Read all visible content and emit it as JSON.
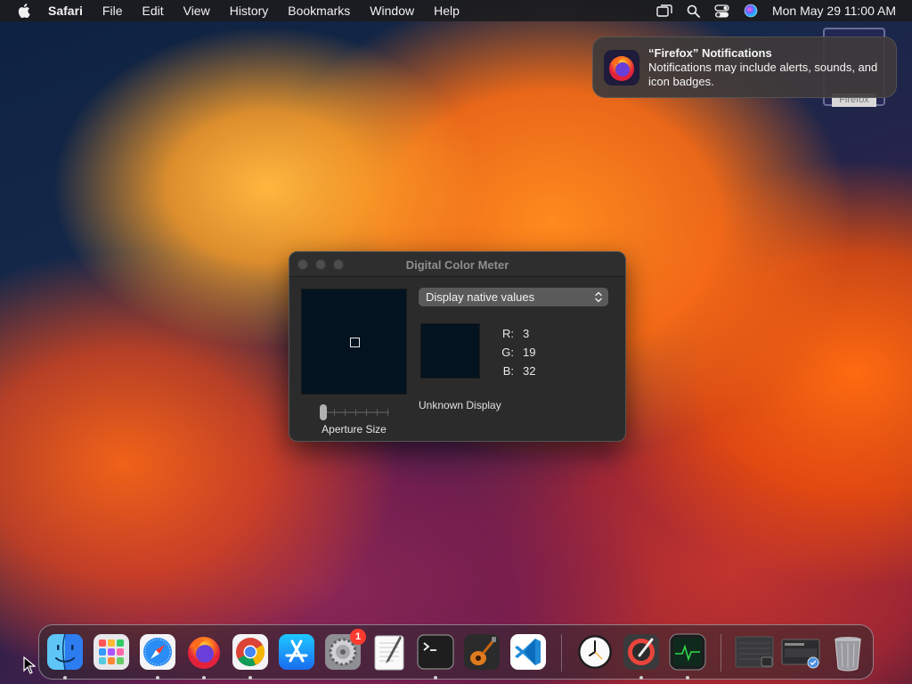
{
  "menubar": {
    "app_name": "Safari",
    "menus": [
      "File",
      "Edit",
      "View",
      "History",
      "Bookmarks",
      "Window",
      "Help"
    ],
    "clock": "Mon May 29  11:00 AM",
    "status_icons": [
      "screen-mirroring-icon",
      "search-icon",
      "control-center-icon",
      "siri-icon"
    ]
  },
  "notification": {
    "title": "“Firefox” Notifications",
    "body": "Notifications may include alerts, sounds, and icon badges.",
    "tag_label": "Firefox"
  },
  "dcm": {
    "title": "Digital Color Meter",
    "select_value": "Display native values",
    "r_label": "R:",
    "r_value": "3",
    "g_label": "G:",
    "g_value": "19",
    "b_label": "B:",
    "b_value": "32",
    "display_label": "Unknown Display",
    "aperture_label": "Aperture Size",
    "aperture_level": 0,
    "sampled_color": "#031320"
  },
  "dock": {
    "items": [
      "finder-icon",
      "launchpad-icon",
      "safari-icon",
      "firefox-icon",
      "chrome-icon",
      "app-store-icon",
      "system-settings-icon",
      "textedit-icon",
      "terminal-icon",
      "garageband-icon",
      "vscode-icon",
      "clock-icon",
      "digital-color-meter-icon",
      "activity-monitor-icon",
      "minimized-window-icon",
      "downloads-stack-icon",
      "trash-icon"
    ],
    "settings_badge": "1"
  }
}
